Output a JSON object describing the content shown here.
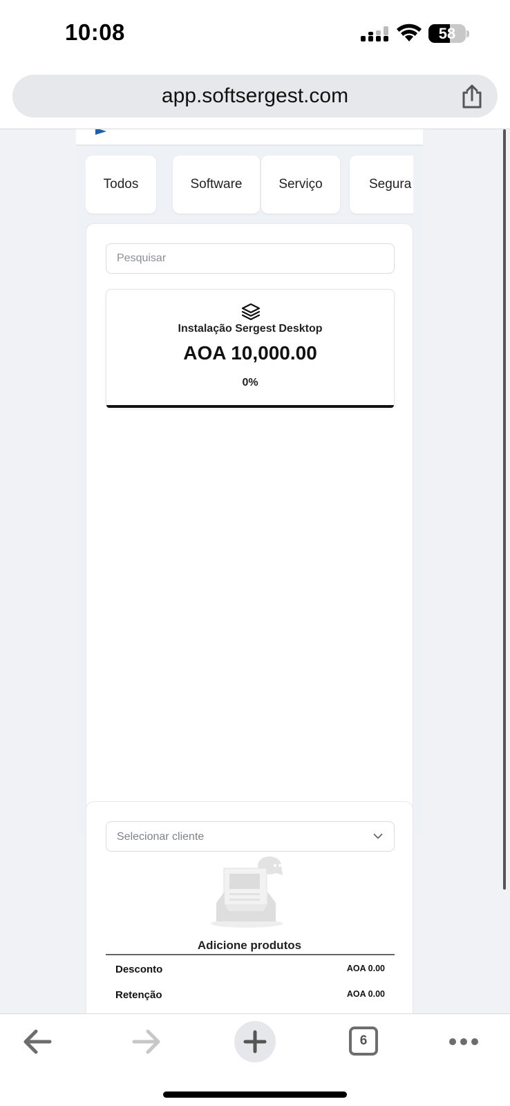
{
  "status_bar": {
    "time": "10:08",
    "battery_level": "58",
    "icons": [
      "cellular-signal-icon",
      "wifi-icon",
      "battery-icon"
    ]
  },
  "browser": {
    "url": "app.softsergest.com",
    "share_icon": "share-icon",
    "tab_count": "6",
    "toolbar_icons": [
      "back-arrow-icon",
      "forward-arrow-icon",
      "plus-icon",
      "tabs-icon",
      "more-icon"
    ]
  },
  "categories": {
    "tabs": [
      {
        "label": "Todos"
      },
      {
        "label": "Software"
      },
      {
        "label": "Serviço"
      },
      {
        "label": "Segura"
      }
    ]
  },
  "search": {
    "placeholder": "Pesquisar"
  },
  "products": [
    {
      "icon": "layers-icon",
      "name": "Instalação Sergest Desktop",
      "price": "AOA 10,000.00",
      "discount": "0%"
    }
  ],
  "cart": {
    "client_placeholder": "Selecionar cliente",
    "empty_message": "Adicione produtos",
    "summary": [
      {
        "label": "Desconto",
        "value": "AOA 0.00"
      },
      {
        "label": "Retenção",
        "value": "AOA 0.00"
      }
    ]
  },
  "colors": {
    "page_background": "#eef1f6",
    "card_background": "#ffffff",
    "address_bar": "#e6e8eb",
    "logo_blue": "#1f5fa8"
  }
}
